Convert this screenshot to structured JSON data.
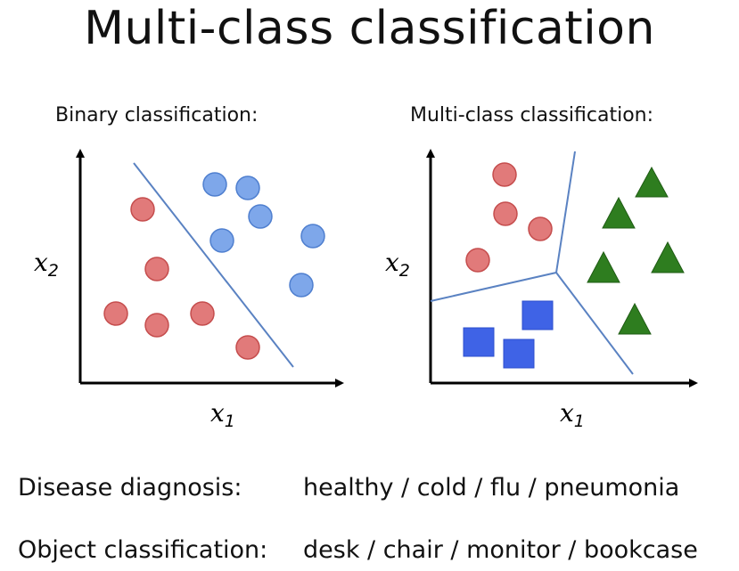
{
  "title": "Multi-class classification",
  "panels": {
    "binary": {
      "title": "Binary classification:",
      "x_label": "x",
      "x_sub": "1",
      "y_label": "x",
      "y_sub": "2"
    },
    "multi": {
      "title": "Multi-class classification:",
      "x_label": "x",
      "x_sub": "1",
      "y_label": "x",
      "y_sub": "2"
    }
  },
  "colors": {
    "red_class": "#e17a7a",
    "blue_class": "#7ea7ea",
    "green_class": "#2e7d1f",
    "square_class": "#3f63e6",
    "boundary": "#5a82c2",
    "axis": "#000000"
  },
  "examples": [
    {
      "label": "Disease diagnosis:",
      "value": "healthy / cold / flu / pneumonia"
    },
    {
      "label": "Object classification:",
      "value": "desk / chair / monitor / bookcase"
    }
  ]
}
